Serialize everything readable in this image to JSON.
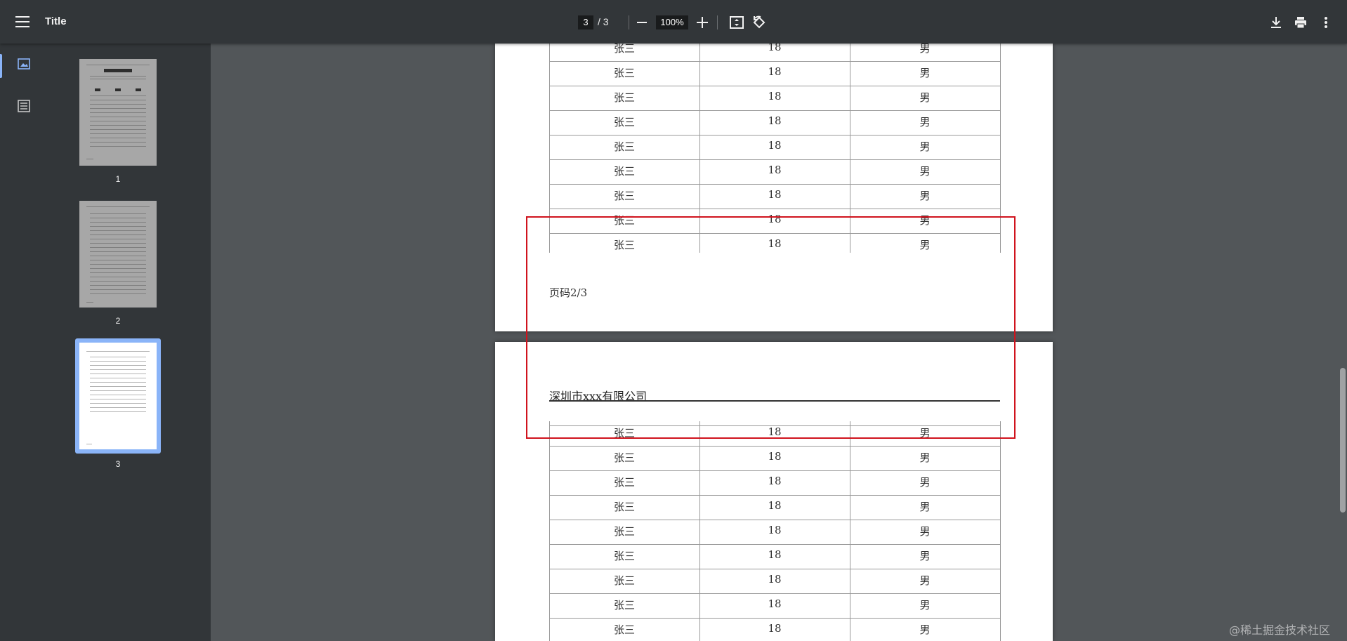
{
  "toolbar": {
    "title": "Title",
    "current_page": "3",
    "page_separator": "/ 3",
    "zoom": "100%"
  },
  "sidebar": {
    "thumbnails": [
      {
        "label": "1"
      },
      {
        "label": "2"
      },
      {
        "label": "3",
        "selected": true
      }
    ]
  },
  "document": {
    "row": {
      "name": "张三",
      "age": "18",
      "gender": "男"
    },
    "page2_footer": "页码2/3",
    "page3_header": "深圳市xxx有限公司"
  },
  "watermark": "@稀土掘金技术社区",
  "colors": {
    "toolbar_bg": "#323639",
    "viewer_bg": "#525659",
    "selection_blue": "#8ab4f8",
    "annotation_red": "#d0131d"
  }
}
